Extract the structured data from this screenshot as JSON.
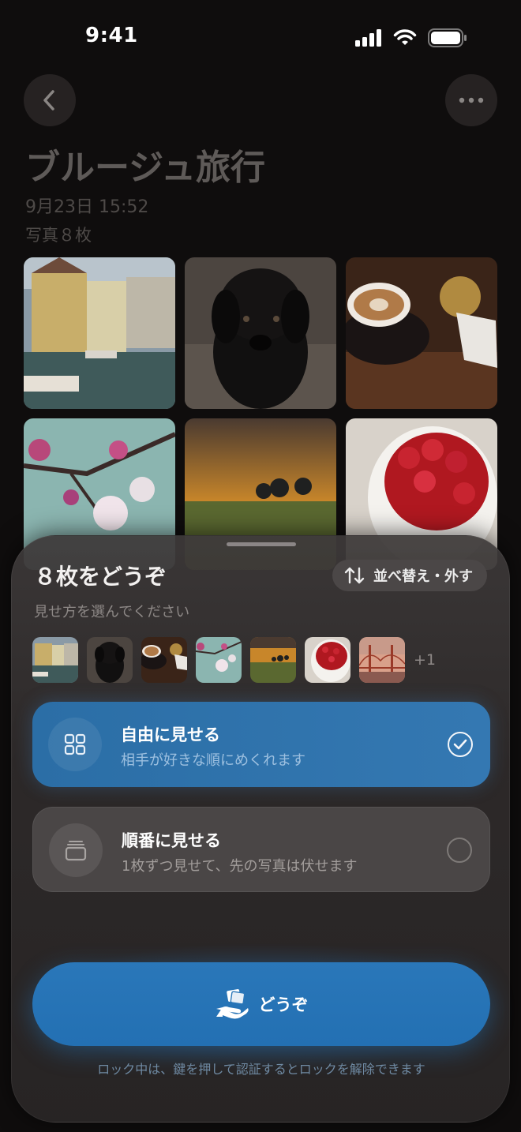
{
  "status_bar": {
    "time": "9:41"
  },
  "header": {
    "title": "ブルージュ旅行",
    "date": "9月23日 15:52",
    "photo_count": "写真８枚"
  },
  "sheet": {
    "title": "８枚をどうぞ",
    "subtitle": "見せ方を選んでください",
    "reorder_label": "並べ替え・外す",
    "more_count": "+1",
    "options": [
      {
        "title": "自由に見せる",
        "desc": "相手が好きな順にめくれます",
        "selected": true
      },
      {
        "title": "順番に見せる",
        "desc": "1枚ずつ見せて、先の写真は伏せます",
        "selected": false
      }
    ],
    "give_label": "どうぞ",
    "lock_note": "ロック中は、鍵を押して認証するとロックを解除できます"
  },
  "photos": [
    "canal",
    "black-dog",
    "latte",
    "cherry-blossom",
    "sunset-field",
    "raspberries",
    "golden-gate"
  ],
  "colors": {
    "accent": "#2a77b9",
    "background": "#0f0d0d",
    "sheet": "#2e2a2a"
  }
}
